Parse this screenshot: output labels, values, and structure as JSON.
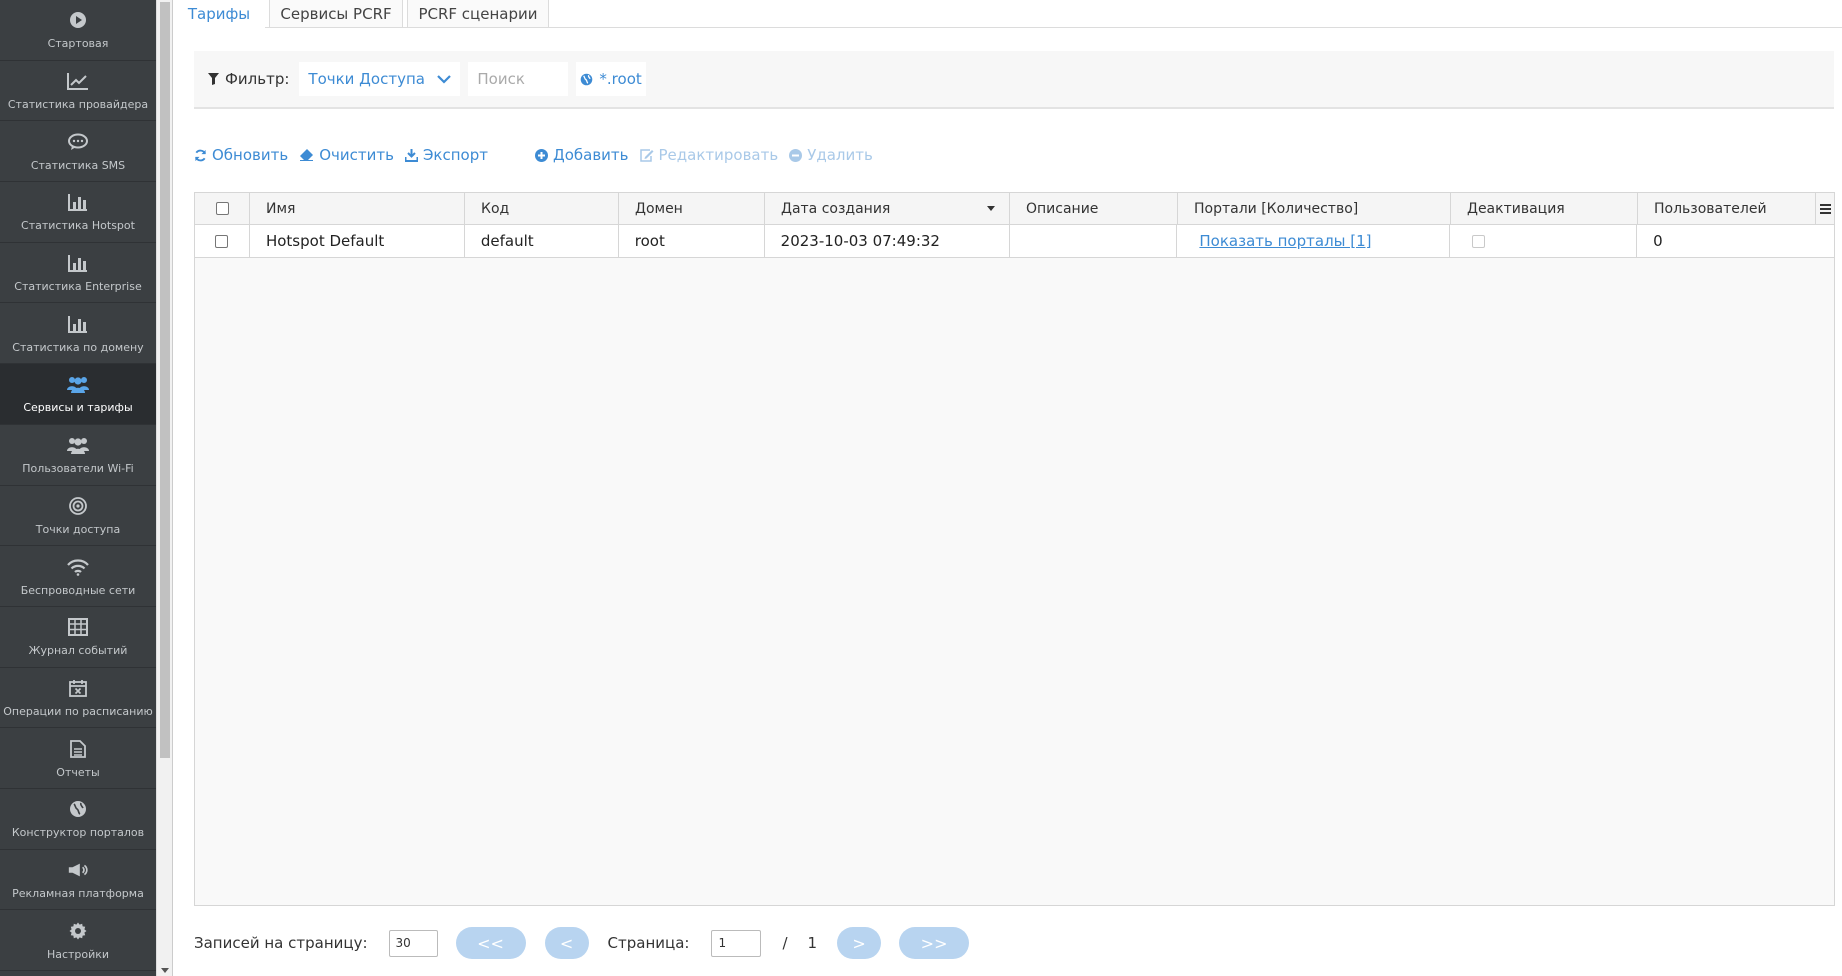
{
  "sidebar": {
    "items": [
      {
        "label": "Стартовая",
        "icon": "play-circle-icon"
      },
      {
        "label": "Статистика провайдера",
        "icon": "line-chart-icon"
      },
      {
        "label": "Статистика SMS",
        "icon": "chat-bubble-icon"
      },
      {
        "label": "Статистика Hotspot",
        "icon": "bar-chart-icon"
      },
      {
        "label": "Статистика Enterprise",
        "icon": "bar-chart-icon"
      },
      {
        "label": "Статистика по домену",
        "icon": "bar-chart-icon"
      },
      {
        "label": "Сервисы и тарифы",
        "icon": "users-group-icon",
        "active": true
      },
      {
        "label": "Пользователи Wi-Fi",
        "icon": "users-group-icon"
      },
      {
        "label": "Точки доступа",
        "icon": "target-icon"
      },
      {
        "label": "Беспроводные сети",
        "icon": "wifi-icon"
      },
      {
        "label": "Журнал событий",
        "icon": "table-icon"
      },
      {
        "label": "Операции по расписанию",
        "icon": "calendar-x-icon"
      },
      {
        "label": "Отчеты",
        "icon": "document-icon"
      },
      {
        "label": "Конструктор порталов",
        "icon": "globe-icon"
      },
      {
        "label": "Рекламная платформа",
        "icon": "megaphone-icon"
      },
      {
        "label": "Настройки",
        "icon": "gear-icon"
      }
    ]
  },
  "tabs": [
    {
      "label": "Тарифы",
      "active": true
    },
    {
      "label": "Сервисы PCRF"
    },
    {
      "label": "PCRF сценарии"
    }
  ],
  "filter": {
    "label": "Фильтр:",
    "select_value": "Точки Доступа",
    "search_placeholder": "Поиск",
    "domain": "*.root"
  },
  "toolbar": {
    "refresh": "Обновить",
    "clear": "Очистить",
    "export": "Экспорт",
    "add": "Добавить",
    "edit": "Редактировать",
    "delete": "Удалить"
  },
  "table": {
    "columns": [
      "Имя",
      "Код",
      "Домен",
      "Дата создания",
      "Описание",
      "Портали [Количество]",
      "Деактивация",
      "Пользователей"
    ],
    "rows": [
      {
        "name": "Hotspot Default",
        "code": "default",
        "domain": "root",
        "created": "2023-10-03 07:49:32",
        "description": "",
        "portals": "Показать порталы [1]",
        "deactivated": false,
        "users": "0"
      }
    ]
  },
  "pager": {
    "per_page_label": "Записей на страницу:",
    "per_page_value": "30",
    "first": "<<",
    "prev": "<",
    "page_label": "Страница:",
    "page_value": "1",
    "separator": "/",
    "total_pages": "1",
    "next": ">",
    "last": ">>"
  },
  "colors": {
    "sidebar_bg": "#3b3f42",
    "accent": "#3d8bd4",
    "disabled_accent": "#a9c9e8",
    "pager_button": "#b8d4f0"
  }
}
